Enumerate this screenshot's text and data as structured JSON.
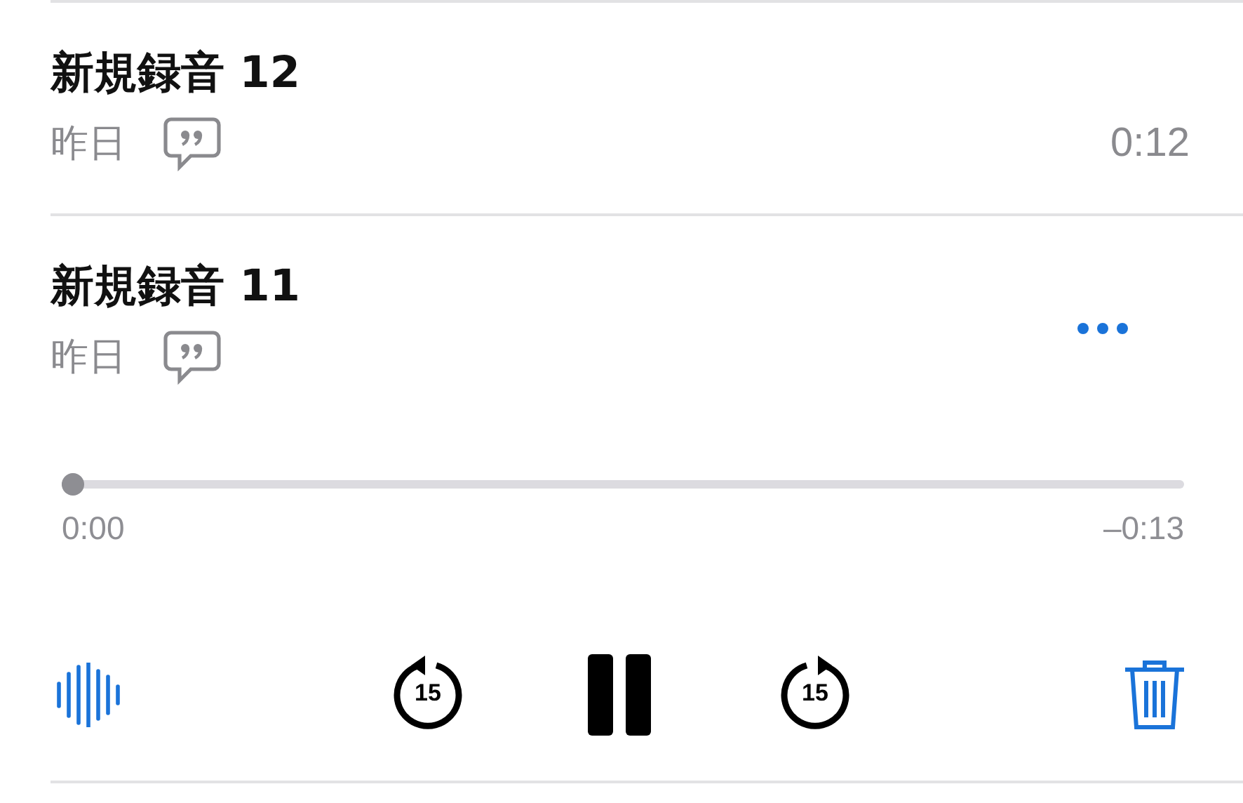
{
  "recordings": [
    {
      "title": "新規録音 12",
      "date": "昨日",
      "has_transcript": true,
      "duration": "0:12",
      "expanded": false
    },
    {
      "title": "新規録音 11",
      "date": "昨日",
      "has_transcript": true,
      "expanded": true
    }
  ],
  "player": {
    "level": 0.01,
    "elapsed": "0:00",
    "remaining": "–0:13",
    "playing": true,
    "skip_back_label": "15",
    "skip_forward_label": "15"
  }
}
